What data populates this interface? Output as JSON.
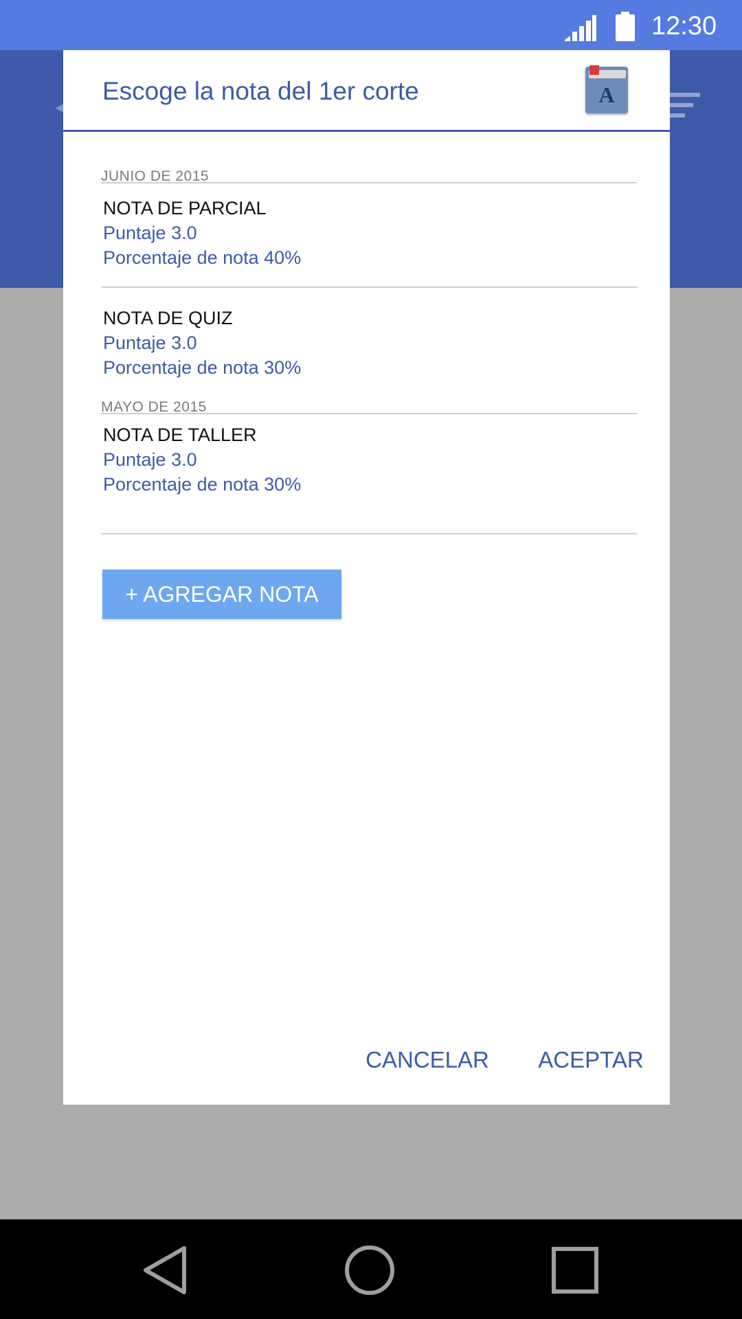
{
  "status_bar": {
    "time": "12:30",
    "icons": [
      "signal-icon",
      "battery-icon"
    ]
  },
  "dialog": {
    "title": "Escoge la nota del 1er corte",
    "icon": "book-icon",
    "icon_letter": "A",
    "sections": [
      {
        "label": "JUNIO DE 2015",
        "items": [
          {
            "title": "NOTA DE PARCIAL",
            "score": "Puntaje 3.0",
            "percent": "Porcentaje de nota 40%"
          },
          {
            "title": "NOTA DE QUIZ",
            "score": "Puntaje 3.0",
            "percent": "Porcentaje de nota 30%"
          }
        ]
      },
      {
        "label": "MAYO DE 2015",
        "items": [
          {
            "title": "NOTA DE TALLER",
            "score": "Puntaje 3.0",
            "percent": "Porcentaje de nota 30%"
          }
        ]
      }
    ],
    "add_button_label": "+ AGREGAR NOTA",
    "cancel_label": "CANCELAR",
    "accept_label": "ACEPTAR"
  },
  "colors": {
    "status_bar": "#557be0",
    "app_bar": "#3e5aa8",
    "accent_text": "#3e5aa8",
    "add_button": "#6da7f0",
    "scrim": "#ababab"
  },
  "nav_bar": {
    "icons": [
      "back-icon",
      "home-icon",
      "recents-icon"
    ]
  }
}
